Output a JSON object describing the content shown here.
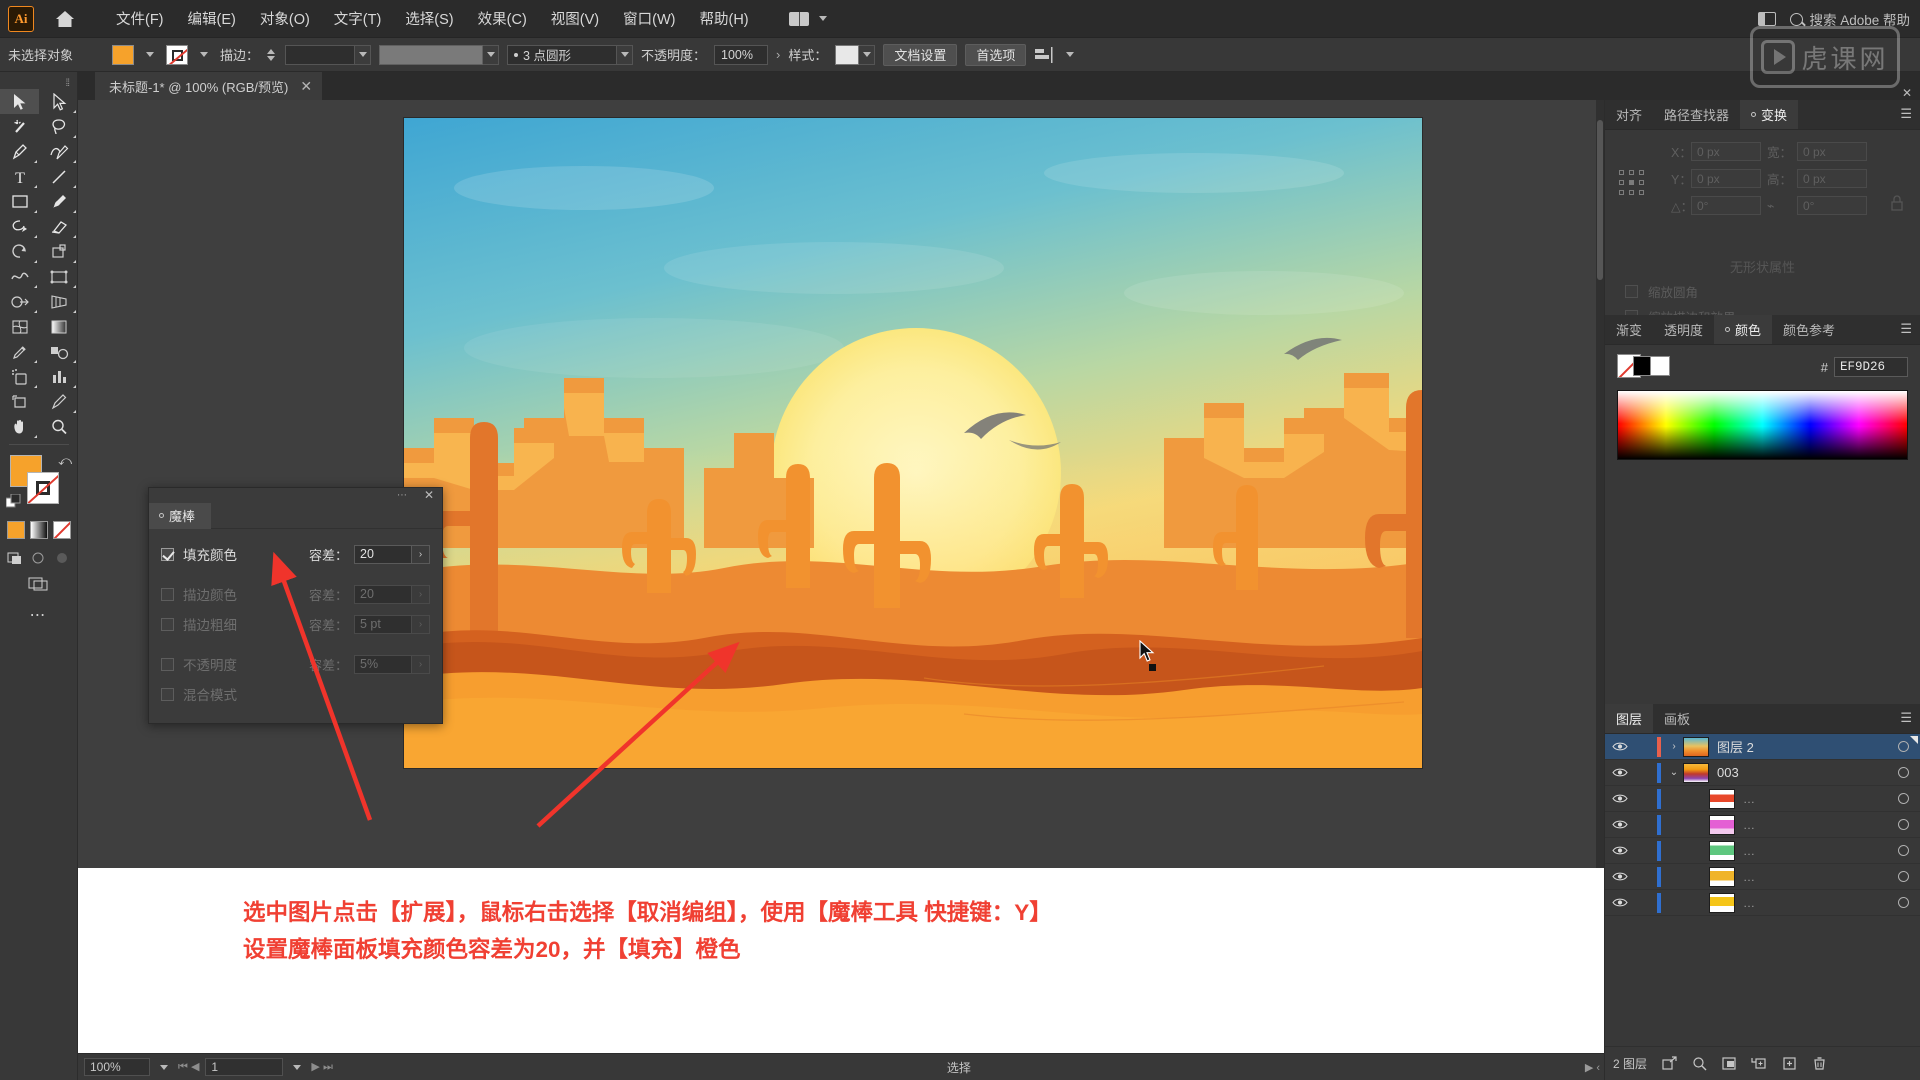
{
  "app": {
    "name": "Adobe Illustrator",
    "logo_text": "Ai"
  },
  "menubar": {
    "items": [
      {
        "label": "文件(F)"
      },
      {
        "label": "编辑(E)"
      },
      {
        "label": "对象(O)"
      },
      {
        "label": "文字(T)"
      },
      {
        "label": "选择(S)"
      },
      {
        "label": "效果(C)"
      },
      {
        "label": "视图(V)"
      },
      {
        "label": "窗口(W)"
      },
      {
        "label": "帮助(H)"
      }
    ],
    "search_placeholder": "搜索 Adobe 帮助"
  },
  "controlbar": {
    "selection_status": "未选择对象",
    "stroke_label": "描边：",
    "stroke_weight": "",
    "stroke_profile": "",
    "brush_definition": "",
    "brush_style": "3 点圆形",
    "opacity_label": "不透明度：",
    "opacity_value": "100%",
    "style_label": "样式：",
    "document_setup": "文档设置",
    "preferences": "首选项"
  },
  "watermark": {
    "text": "虎课网"
  },
  "tabs": {
    "document": "未标题-1* @ 100% (RGB/预览)",
    "close": "✕"
  },
  "toolbox": {
    "tools": [
      {
        "name": "selection-tool",
        "selected": true
      },
      {
        "name": "direct-selection-tool",
        "selected": false
      },
      {
        "name": "magic-wand-tool",
        "selected": false
      },
      {
        "name": "lasso-tool",
        "selected": false
      },
      {
        "name": "pen-tool",
        "selected": false
      },
      {
        "name": "curvature-tool",
        "selected": false
      },
      {
        "name": "type-tool",
        "selected": false
      },
      {
        "name": "line-segment-tool",
        "selected": false
      },
      {
        "name": "rectangle-tool",
        "selected": false
      },
      {
        "name": "paintbrush-tool",
        "selected": false
      },
      {
        "name": "shaper-tool",
        "selected": false
      },
      {
        "name": "eraser-tool",
        "selected": false
      },
      {
        "name": "rotate-tool",
        "selected": false
      },
      {
        "name": "scale-tool",
        "selected": false
      },
      {
        "name": "width-tool",
        "selected": false
      },
      {
        "name": "free-transform-tool",
        "selected": false
      },
      {
        "name": "shape-builder-tool",
        "selected": false
      },
      {
        "name": "perspective-grid-tool",
        "selected": false
      },
      {
        "name": "mesh-tool",
        "selected": false
      },
      {
        "name": "gradient-tool",
        "selected": false
      },
      {
        "name": "eyedropper-tool",
        "selected": false
      },
      {
        "name": "blend-tool",
        "selected": false
      },
      {
        "name": "symbol-sprayer-tool",
        "selected": false
      },
      {
        "name": "column-graph-tool",
        "selected": false
      },
      {
        "name": "artboard-tool",
        "selected": false
      },
      {
        "name": "slice-tool",
        "selected": false
      },
      {
        "name": "hand-tool",
        "selected": false
      },
      {
        "name": "zoom-tool",
        "selected": false
      }
    ],
    "fill_color": "#F6A22B",
    "stroke_color": "none",
    "more_tools": "⋯"
  },
  "magic_wand_panel": {
    "tab_label": "魔棒",
    "rows": [
      {
        "label": "填充颜色",
        "checked": true,
        "tolerance_label": "容差：",
        "tolerance_value": "20",
        "enabled": true
      },
      {
        "label": "描边颜色",
        "checked": false,
        "tolerance_label": "容差：",
        "tolerance_value": "20",
        "enabled": false
      },
      {
        "label": "描边粗细",
        "checked": false,
        "tolerance_label": "容差：",
        "tolerance_value": "5 pt",
        "enabled": false
      },
      {
        "label": "不透明度",
        "checked": false,
        "tolerance_label": "容差：",
        "tolerance_value": "5%",
        "enabled": false
      },
      {
        "label": "混合模式",
        "checked": false,
        "tolerance_label": "",
        "tolerance_value": "",
        "enabled": false
      }
    ]
  },
  "transform_panel": {
    "tabs": [
      {
        "label": "对齐",
        "active": false
      },
      {
        "label": "路径查找器",
        "active": false
      },
      {
        "label": "变换",
        "active": true
      }
    ],
    "fields": [
      {
        "label": "X：",
        "value": "0 px"
      },
      {
        "label": "宽：",
        "value": "0 px"
      },
      {
        "label": "Y：",
        "value": "0 px"
      },
      {
        "label": "高：",
        "value": "0 px"
      },
      {
        "label": "△：",
        "value": "0°"
      },
      {
        "label": "",
        "value": "0°"
      }
    ],
    "empty_text": "无形状属性",
    "checkboxes": [
      {
        "label": "缩放圆角"
      },
      {
        "label": "缩放描边和效果"
      }
    ]
  },
  "color_panel": {
    "tabs": [
      {
        "label": "渐变",
        "active": false
      },
      {
        "label": "透明度",
        "active": false
      },
      {
        "label": "颜色",
        "active": true
      },
      {
        "label": "颜色参考",
        "active": false
      }
    ],
    "hash": "#",
    "hex_value": "EF9D26"
  },
  "layers_panel": {
    "tabs": [
      {
        "label": "图层",
        "active": true
      },
      {
        "label": "画板",
        "active": false
      }
    ],
    "rows": [
      {
        "name": "图层 2",
        "selected": true,
        "indent": 0,
        "color": "#e8604c",
        "thumb": "sunset",
        "expander": "›"
      },
      {
        "name": "003",
        "selected": false,
        "indent": 1,
        "color": "#2f6fd0",
        "thumb": "multi",
        "expander": "⌄"
      },
      {
        "name": "…",
        "selected": false,
        "indent": 2,
        "color": "#2f6fd0",
        "thumb": "red",
        "expander": ""
      },
      {
        "name": "…",
        "selected": false,
        "indent": 2,
        "color": "#2f6fd0",
        "thumb": "magenta",
        "expander": ""
      },
      {
        "name": "…",
        "selected": false,
        "indent": 2,
        "color": "#2f6fd0",
        "thumb": "green",
        "expander": ""
      },
      {
        "name": "…",
        "selected": false,
        "indent": 2,
        "color": "#2f6fd0",
        "thumb": "orange",
        "expander": ""
      },
      {
        "name": "…",
        "selected": false,
        "indent": 2,
        "color": "#2f6fd0",
        "thumb": "yellow",
        "expander": ""
      }
    ],
    "footer_count": "2 图层",
    "footer_icons": [
      {
        "name": "locate-object-icon"
      },
      {
        "name": "search-icon"
      },
      {
        "name": "make-clipping-mask-icon"
      },
      {
        "name": "create-sublayer-icon"
      },
      {
        "name": "create-new-layer-icon"
      },
      {
        "name": "delete-layer-icon"
      }
    ]
  },
  "annotation": {
    "line1": "选中图片点击【扩展】，鼠标右击选择【取消编组】，使用【魔棒工具 快捷键：Y】",
    "line2": "设置魔棒面板填充颜色容差为20，并【填充】橙色",
    "color": "#F04033"
  },
  "statusbar": {
    "zoom": "100%",
    "page": "1",
    "status_text": "选择"
  }
}
